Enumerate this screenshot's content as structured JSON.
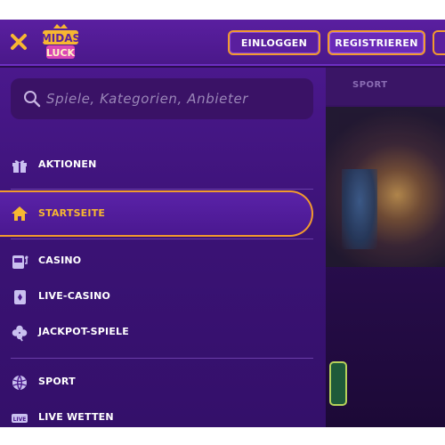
{
  "header": {
    "close_label": "✕",
    "logo": {
      "line1": "MIDAS",
      "line2": "LUCK"
    },
    "login_label": "EINLOGGEN",
    "register_label": "REGISTRIEREN"
  },
  "search": {
    "placeholder": "Spiele, Kategorien, Anbieter"
  },
  "menu": {
    "items": [
      {
        "label": "AKTIONEN",
        "icon": "gift-icon"
      },
      {
        "label": "STARTSEITE",
        "icon": "home-icon",
        "active": true
      },
      {
        "label": "CASINO",
        "icon": "slot-machine-icon"
      },
      {
        "label": "LIVE-CASINO",
        "icon": "playing-card-icon"
      },
      {
        "label": "JACKPOT-SPIELE",
        "icon": "clover-icon"
      },
      {
        "label": "SPORT",
        "icon": "ball-icon"
      },
      {
        "label": "LIVE WETTEN",
        "icon": "live-badge-icon",
        "badge": "LIVE"
      }
    ]
  },
  "background": {
    "tab_label": "SPORT"
  },
  "colors": {
    "accent": "#f29a2e",
    "active_text": "#f7b731",
    "sidebar": "#4a188c"
  }
}
